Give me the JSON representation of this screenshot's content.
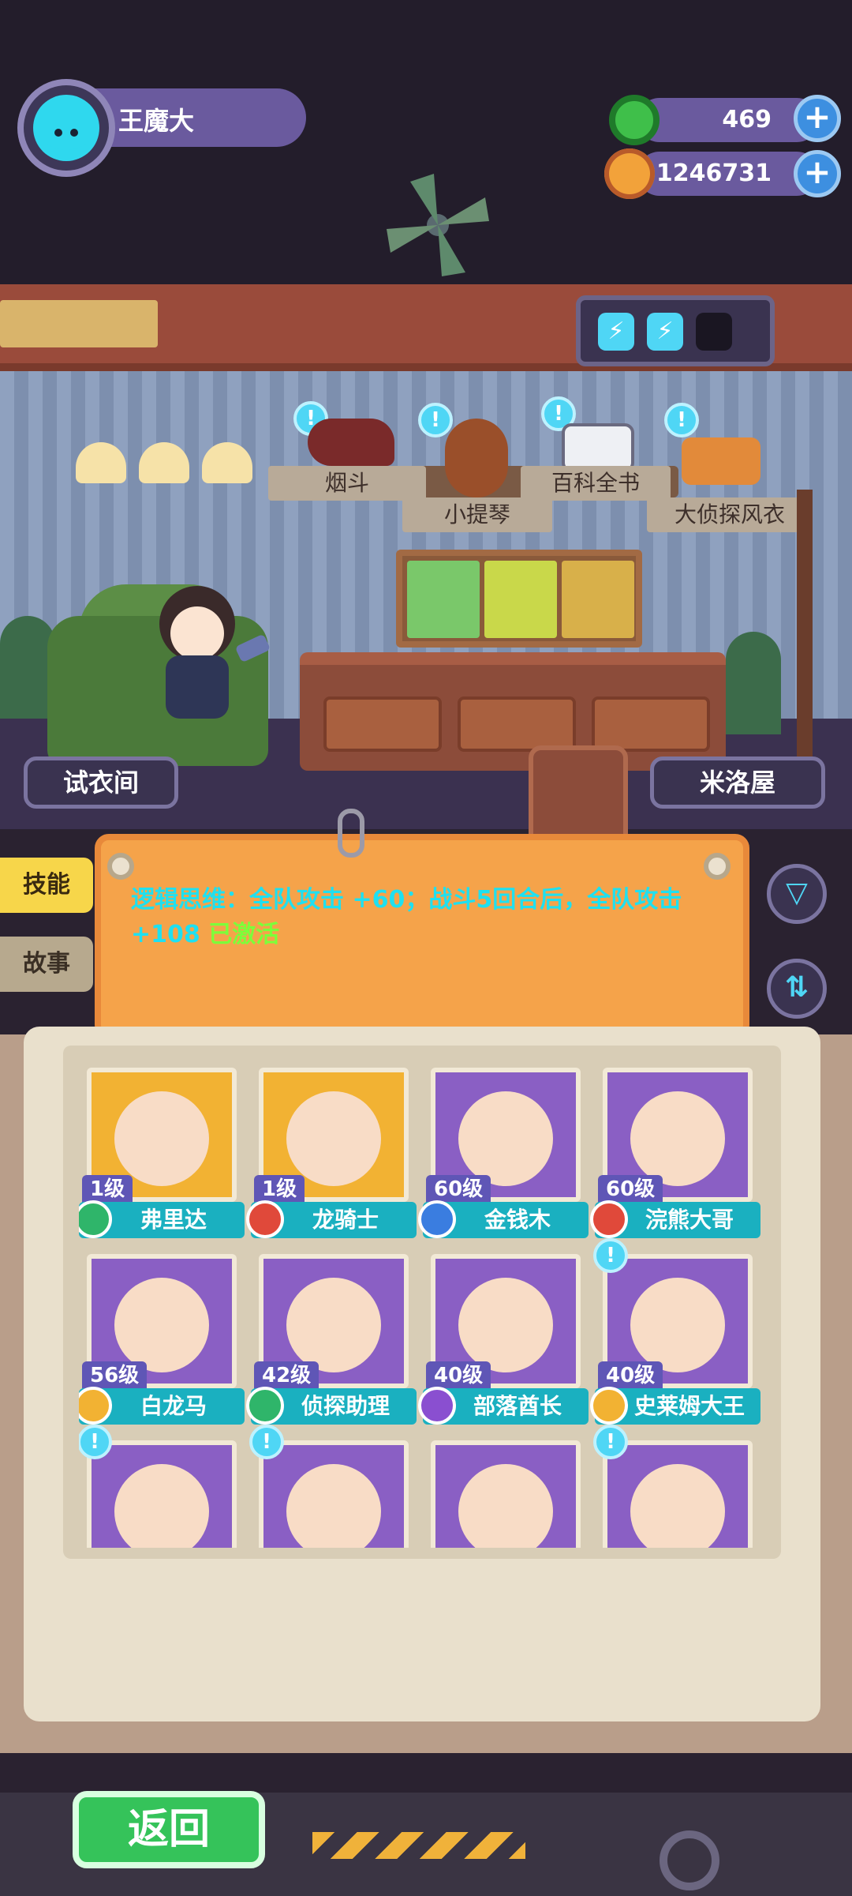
{
  "player": {
    "name": "王魔大"
  },
  "resources": [
    {
      "icon": "donut-coin-icon",
      "value": "469",
      "color": "#3fbf4a"
    },
    {
      "icon": "planet-coin-icon",
      "value": "1246731",
      "color": "#f2a23a"
    }
  ],
  "room": {
    "items": [
      {
        "icon": "pipe-icon",
        "label": "烟斗"
      },
      {
        "icon": "violin-icon",
        "label": "小提琴"
      },
      {
        "icon": "encyclopedia-icon",
        "label": "百科全书"
      },
      {
        "icon": "coat-icon",
        "label": "大侦探风衣"
      }
    ],
    "left_button": "试衣间",
    "right_button": "米洛屋"
  },
  "tabs": [
    {
      "label": "技能",
      "active": true
    },
    {
      "label": "故事",
      "active": false
    }
  ],
  "skill": {
    "text": "逻辑思维：全队攻击 +60；战斗5回合后，全队攻击 +108",
    "status": "已激活"
  },
  "characters": [
    {
      "level": "1级",
      "name": "弗里达",
      "badge_color": "#2fb56a",
      "card_color": "#f2b233",
      "has_bubble": false
    },
    {
      "level": "1级",
      "name": "龙骑士",
      "badge_color": "#e0493a",
      "card_color": "#f2b233",
      "has_bubble": false
    },
    {
      "level": "60级",
      "name": "金钱木",
      "badge_color": "#3a7de0",
      "card_color": "#8a5fc4",
      "has_bubble": false
    },
    {
      "level": "60级",
      "name": "浣熊大哥",
      "badge_color": "#e0493a",
      "card_color": "#8a5fc4",
      "has_bubble": false
    },
    {
      "level": "56级",
      "name": "白龙马",
      "badge_color": "#f2b233",
      "card_color": "#8a5fc4",
      "has_bubble": false
    },
    {
      "level": "42级",
      "name": "侦探助理",
      "badge_color": "#2fb56a",
      "card_color": "#8a5fc4",
      "has_bubble": false
    },
    {
      "level": "40级",
      "name": "部落酋长",
      "badge_color": "#8a4fd0",
      "card_color": "#8a5fc4",
      "has_bubble": false
    },
    {
      "level": "40级",
      "name": "史莱姆大王",
      "badge_color": "#f2b233",
      "card_color": "#8a5fc4",
      "has_bubble": true
    },
    {
      "level": "",
      "name": "",
      "badge_color": "#8a5fc4",
      "card_color": "#8a5fc4",
      "has_bubble": true
    },
    {
      "level": "",
      "name": "",
      "badge_color": "#8a5fc4",
      "card_color": "#8a5fc4",
      "has_bubble": true
    },
    {
      "level": "",
      "name": "",
      "badge_color": "#8a5fc4",
      "card_color": "#8a5fc4",
      "has_bubble": false
    },
    {
      "level": "",
      "name": "",
      "badge_color": "#8a5fc4",
      "card_color": "#8a5fc4",
      "has_bubble": true
    }
  ],
  "back_button": "返回",
  "icons": {
    "filter": "filter-icon",
    "sort": "sort-icon",
    "wardrobe": "wardrobe-icon",
    "energy": "lightning-icon"
  }
}
